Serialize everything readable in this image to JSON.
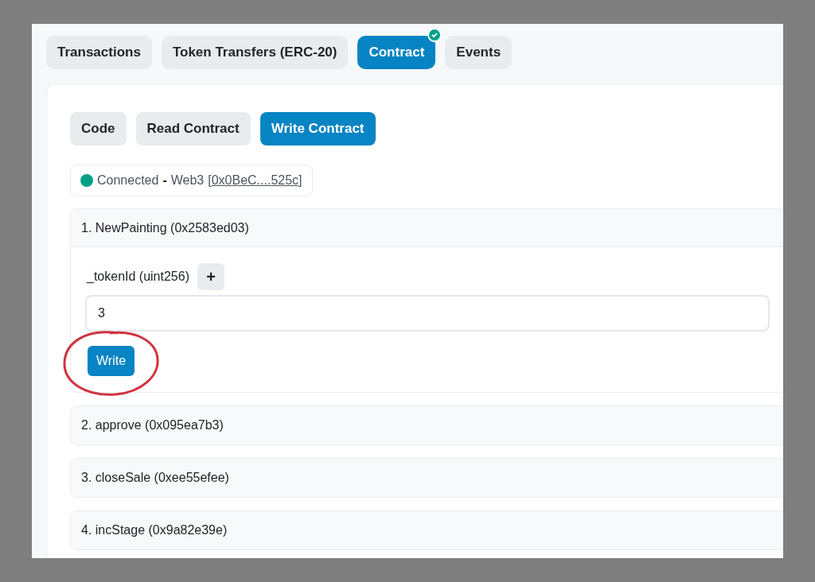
{
  "tabs": [
    {
      "label": "Transactions",
      "selected": false,
      "verified": false
    },
    {
      "label": "Token Transfers (ERC-20)",
      "selected": false,
      "verified": false
    },
    {
      "label": "Contract",
      "selected": true,
      "verified": true
    },
    {
      "label": "Events",
      "selected": false,
      "verified": false
    }
  ],
  "sub_tabs": [
    {
      "label": "Code",
      "selected": false
    },
    {
      "label": "Read Contract",
      "selected": false
    },
    {
      "label": "Write Contract",
      "selected": true
    }
  ],
  "connection": {
    "connected": true,
    "status": "Connected",
    "separator": "-",
    "provider": "Web3",
    "bracket_open": "[",
    "address": "0x0BeC....525c",
    "bracket_close": "]"
  },
  "functions": [
    {
      "title": "1. NewPainting (0x2583ed03)",
      "expanded": true,
      "inputs": [
        {
          "label": "_tokenId (uint256)",
          "button": "+",
          "value": "3"
        }
      ],
      "action": "Write"
    },
    {
      "title": "2. approve (0x095ea7b3)",
      "expanded": false
    },
    {
      "title": "3. closeSale (0xee55efee)",
      "expanded": false
    },
    {
      "title": "4. incStage (0x9a82e39e)",
      "expanded": false
    }
  ],
  "annotation": {
    "kind": "circle"
  }
}
